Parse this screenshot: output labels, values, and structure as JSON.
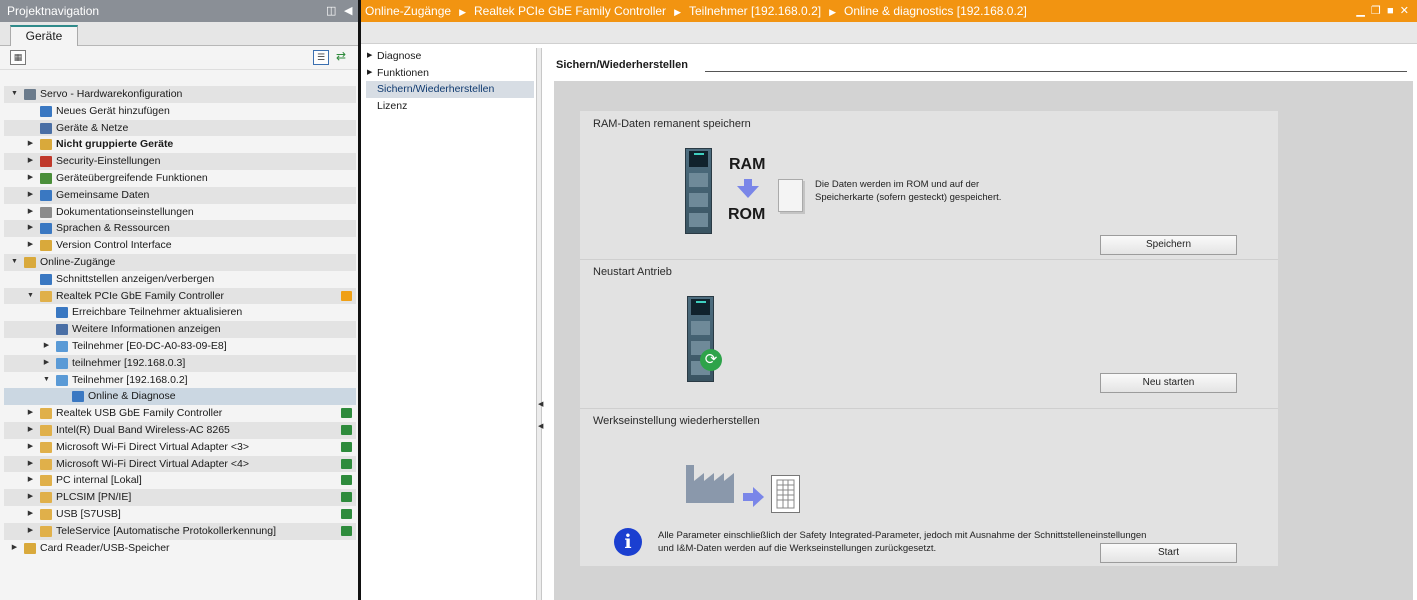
{
  "project_nav": {
    "title": "Projektnavigation",
    "tab": "Geräte",
    "tree": [
      {
        "label": "Servo - Hardwarekonfiguration",
        "depth": 0,
        "expanded": true,
        "icon": "project-icon"
      },
      {
        "label": "Neues Gerät hinzufügen",
        "depth": 1,
        "icon": "add-device-icon"
      },
      {
        "label": "Geräte & Netze",
        "depth": 1,
        "icon": "network-icon"
      },
      {
        "label": "Nicht gruppierte Geräte",
        "depth": 1,
        "collapsed": true,
        "bold": true,
        "icon": "folder-icon"
      },
      {
        "label": "Security-Einstellungen",
        "depth": 1,
        "collapsed": true,
        "icon": "security-icon"
      },
      {
        "label": "Geräteübergreifende Funktionen",
        "depth": 1,
        "collapsed": true,
        "icon": "functions-icon"
      },
      {
        "label": "Gemeinsame Daten",
        "depth": 1,
        "collapsed": true,
        "icon": "data-icon"
      },
      {
        "label": "Dokumentationseinstellungen",
        "depth": 1,
        "collapsed": true,
        "icon": "documentation-icon"
      },
      {
        "label": "Sprachen & Ressourcen",
        "depth": 1,
        "collapsed": true,
        "icon": "language-icon"
      },
      {
        "label": "Version Control Interface",
        "depth": 1,
        "collapsed": true,
        "icon": "version-control-icon"
      },
      {
        "label": "Online-Zugänge",
        "depth": 0,
        "expanded": true,
        "icon": "online-access-icon"
      },
      {
        "label": "Schnittstellen anzeigen/verbergen",
        "depth": 1,
        "icon": "interface-icon"
      },
      {
        "label": "Realtek PCIe GbE Family Controller",
        "depth": 1,
        "expanded": true,
        "icon": "adapter-icon",
        "flag": "#f0a015"
      },
      {
        "label": "Erreichbare Teilnehmer aktualisieren",
        "depth": 2,
        "icon": "refresh-nodes-icon"
      },
      {
        "label": "Weitere Informationen anzeigen",
        "depth": 2,
        "icon": "info-nodes-icon"
      },
      {
        "label": "Teilnehmer [E0-DC-A0-83-09-E8]",
        "depth": 2,
        "collapsed": true,
        "icon": "node-icon"
      },
      {
        "label": "teilnehmer [192.168.0.3]",
        "depth": 2,
        "collapsed": true,
        "icon": "node-icon"
      },
      {
        "label": "Teilnehmer [192.168.0.2]",
        "depth": 2,
        "expanded": true,
        "icon": "node-icon"
      },
      {
        "label": "Online & Diagnose",
        "depth": 3,
        "selected": true,
        "icon": "diagnostics-icon"
      },
      {
        "label": "Realtek USB GbE Family Controller",
        "depth": 1,
        "collapsed": true,
        "icon": "adapter-icon",
        "flag": "#2e8b3c"
      },
      {
        "label": "Intel(R) Dual Band Wireless-AC 8265",
        "depth": 1,
        "collapsed": true,
        "icon": "adapter-icon",
        "flag": "#2e8b3c"
      },
      {
        "label": "Microsoft Wi-Fi Direct Virtual Adapter <3>",
        "depth": 1,
        "collapsed": true,
        "icon": "adapter-icon",
        "flag": "#2e8b3c"
      },
      {
        "label": "Microsoft Wi-Fi Direct Virtual Adapter <4>",
        "depth": 1,
        "collapsed": true,
        "icon": "adapter-icon",
        "flag": "#2e8b3c"
      },
      {
        "label": "PC internal [Lokal]",
        "depth": 1,
        "collapsed": true,
        "icon": "adapter-icon",
        "flag": "#2e8b3c"
      },
      {
        "label": "PLCSIM [PN/IE]",
        "depth": 1,
        "collapsed": true,
        "icon": "adapter-icon",
        "flag": "#2e8b3c"
      },
      {
        "label": "USB [S7USB]",
        "depth": 1,
        "collapsed": true,
        "icon": "adapter-icon",
        "flag": "#2e8b3c"
      },
      {
        "label": "TeleService [Automatische Protokollerkennung]",
        "depth": 1,
        "collapsed": true,
        "icon": "adapter-icon",
        "flag": "#2e8b3c"
      },
      {
        "label": "Card Reader/USB-Speicher",
        "depth": 0,
        "collapsed": true,
        "icon": "card-reader-icon"
      }
    ]
  },
  "breadcrumb": [
    "Online-Zugänge",
    "Realtek PCIe GbE Family Controller",
    "Teilnehmer [192.168.0.2]",
    "Online & diagnostics [192.168.0.2]"
  ],
  "nav": {
    "items": [
      {
        "label": "Diagnose",
        "has_children": true
      },
      {
        "label": "Funktionen",
        "has_children": true
      },
      {
        "label": "Sichern/Wiederherstellen",
        "active": true
      },
      {
        "label": "Lizenz"
      }
    ]
  },
  "content": {
    "section_title": "Sichern/Wiederherstellen",
    "ram": {
      "title": "RAM-Daten remanent speichern",
      "ram_label": "RAM",
      "rom_label": "ROM",
      "description_1": "Die Daten werden im ROM und auf der",
      "description_2": "Speicherkarte (sofern gesteckt) gespeichert.",
      "button": "Speichern"
    },
    "restart": {
      "title": "Neustart Antrieb",
      "button": "Neu starten"
    },
    "factory": {
      "title": "Werkseinstellung wiederherstellen",
      "button": "Start",
      "info_1": "Alle Parameter einschließlich der Safety Integrated-Parameter, jedoch mit Ausnahme der Schnittstelleneinstellungen",
      "info_2": "und I&M-Daten werden auf die Werkseinstellungen zurückgesetzt."
    }
  },
  "colors": {
    "header": "#f29411",
    "left_title": "#8a8f96",
    "accent_blue": "#7a86e8",
    "info_blue": "#1b3fd0"
  }
}
